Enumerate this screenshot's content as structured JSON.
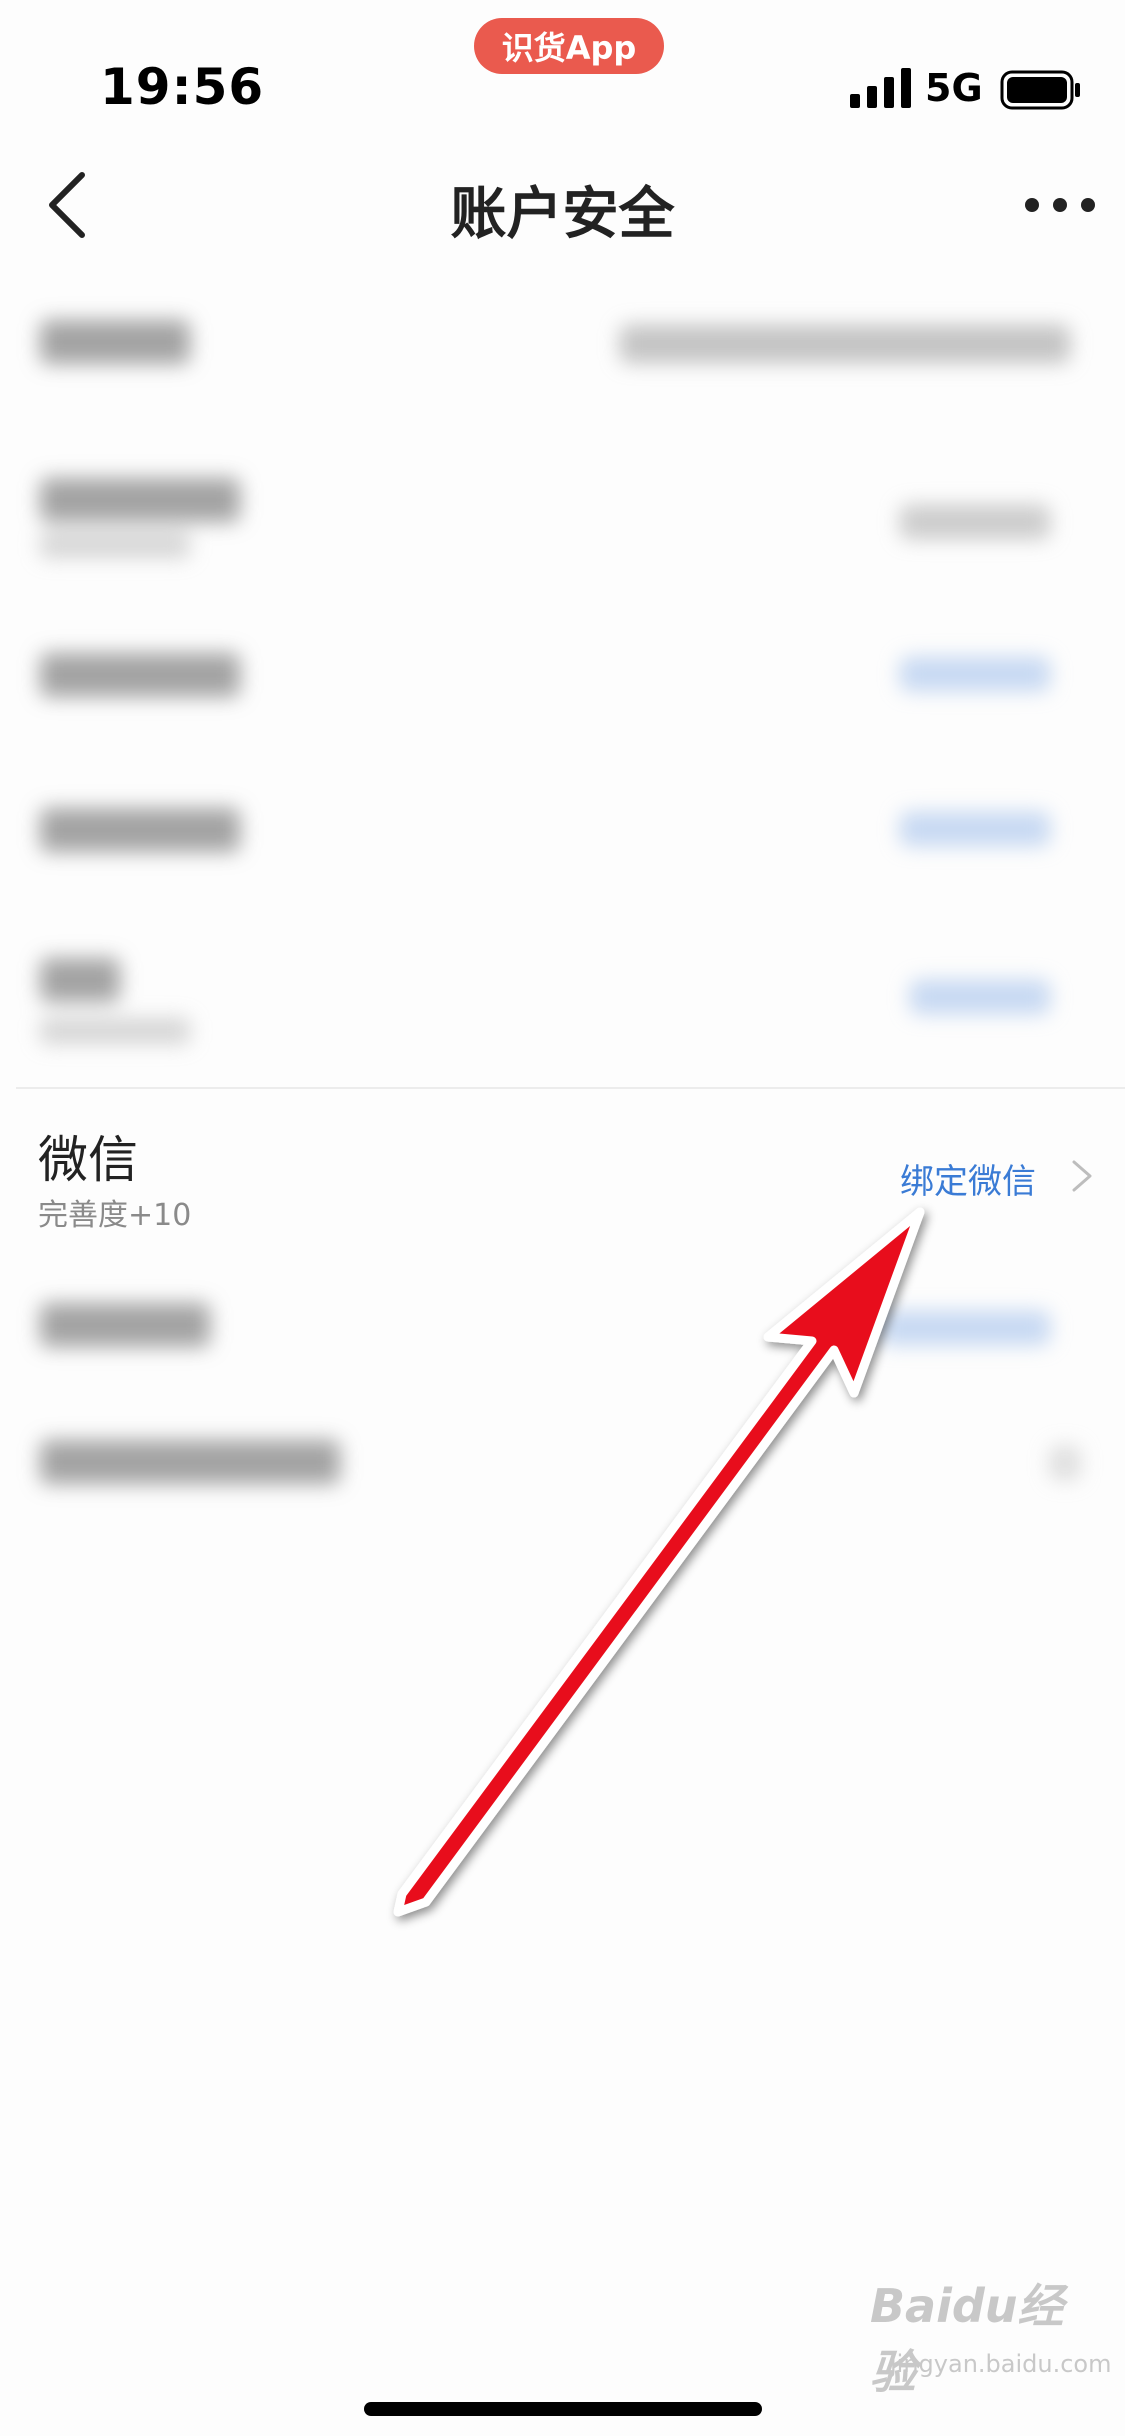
{
  "status_bar": {
    "time": "19:56",
    "app_pill": "识货App",
    "network": "5G"
  },
  "nav": {
    "title": "账户安全"
  },
  "wechat": {
    "title": "微信",
    "subtitle": "完善度+10",
    "action": "绑定微信"
  },
  "watermark": {
    "logo": "Baidu经验",
    "site": "jingyan.baidu.com"
  },
  "colors": {
    "accent": "#3a7bd5",
    "arrow": "#e8101a",
    "app_pill": "#ea5a4e"
  }
}
